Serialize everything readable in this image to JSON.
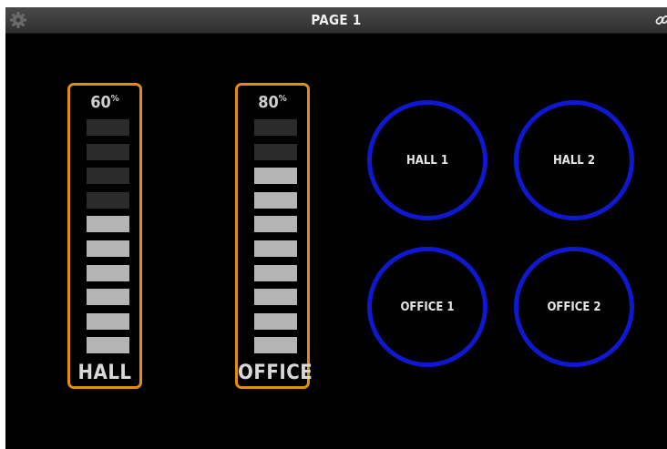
{
  "header": {
    "title": "PAGE 1",
    "settings_icon": "gear-icon",
    "link_icon": "link-icon"
  },
  "faders": [
    {
      "label": "HALL",
      "percent_value": "60",
      "percent_unit": "%",
      "level": 0.6,
      "segments": 10
    },
    {
      "label": "OFFICE",
      "percent_value": "80",
      "percent_unit": "%",
      "level": 0.8,
      "segments": 10
    }
  ],
  "buttons": [
    {
      "label": "HALL 1"
    },
    {
      "label": "HALL 2"
    },
    {
      "label": "OFFICE 1"
    },
    {
      "label": "OFFICE 2"
    }
  ],
  "colors": {
    "background": "#000000",
    "fader_border": "#e08d10",
    "button_ring": "#0f18cf",
    "segment_on": "#b4b4b4",
    "segment_off": "#2b2b2b"
  }
}
